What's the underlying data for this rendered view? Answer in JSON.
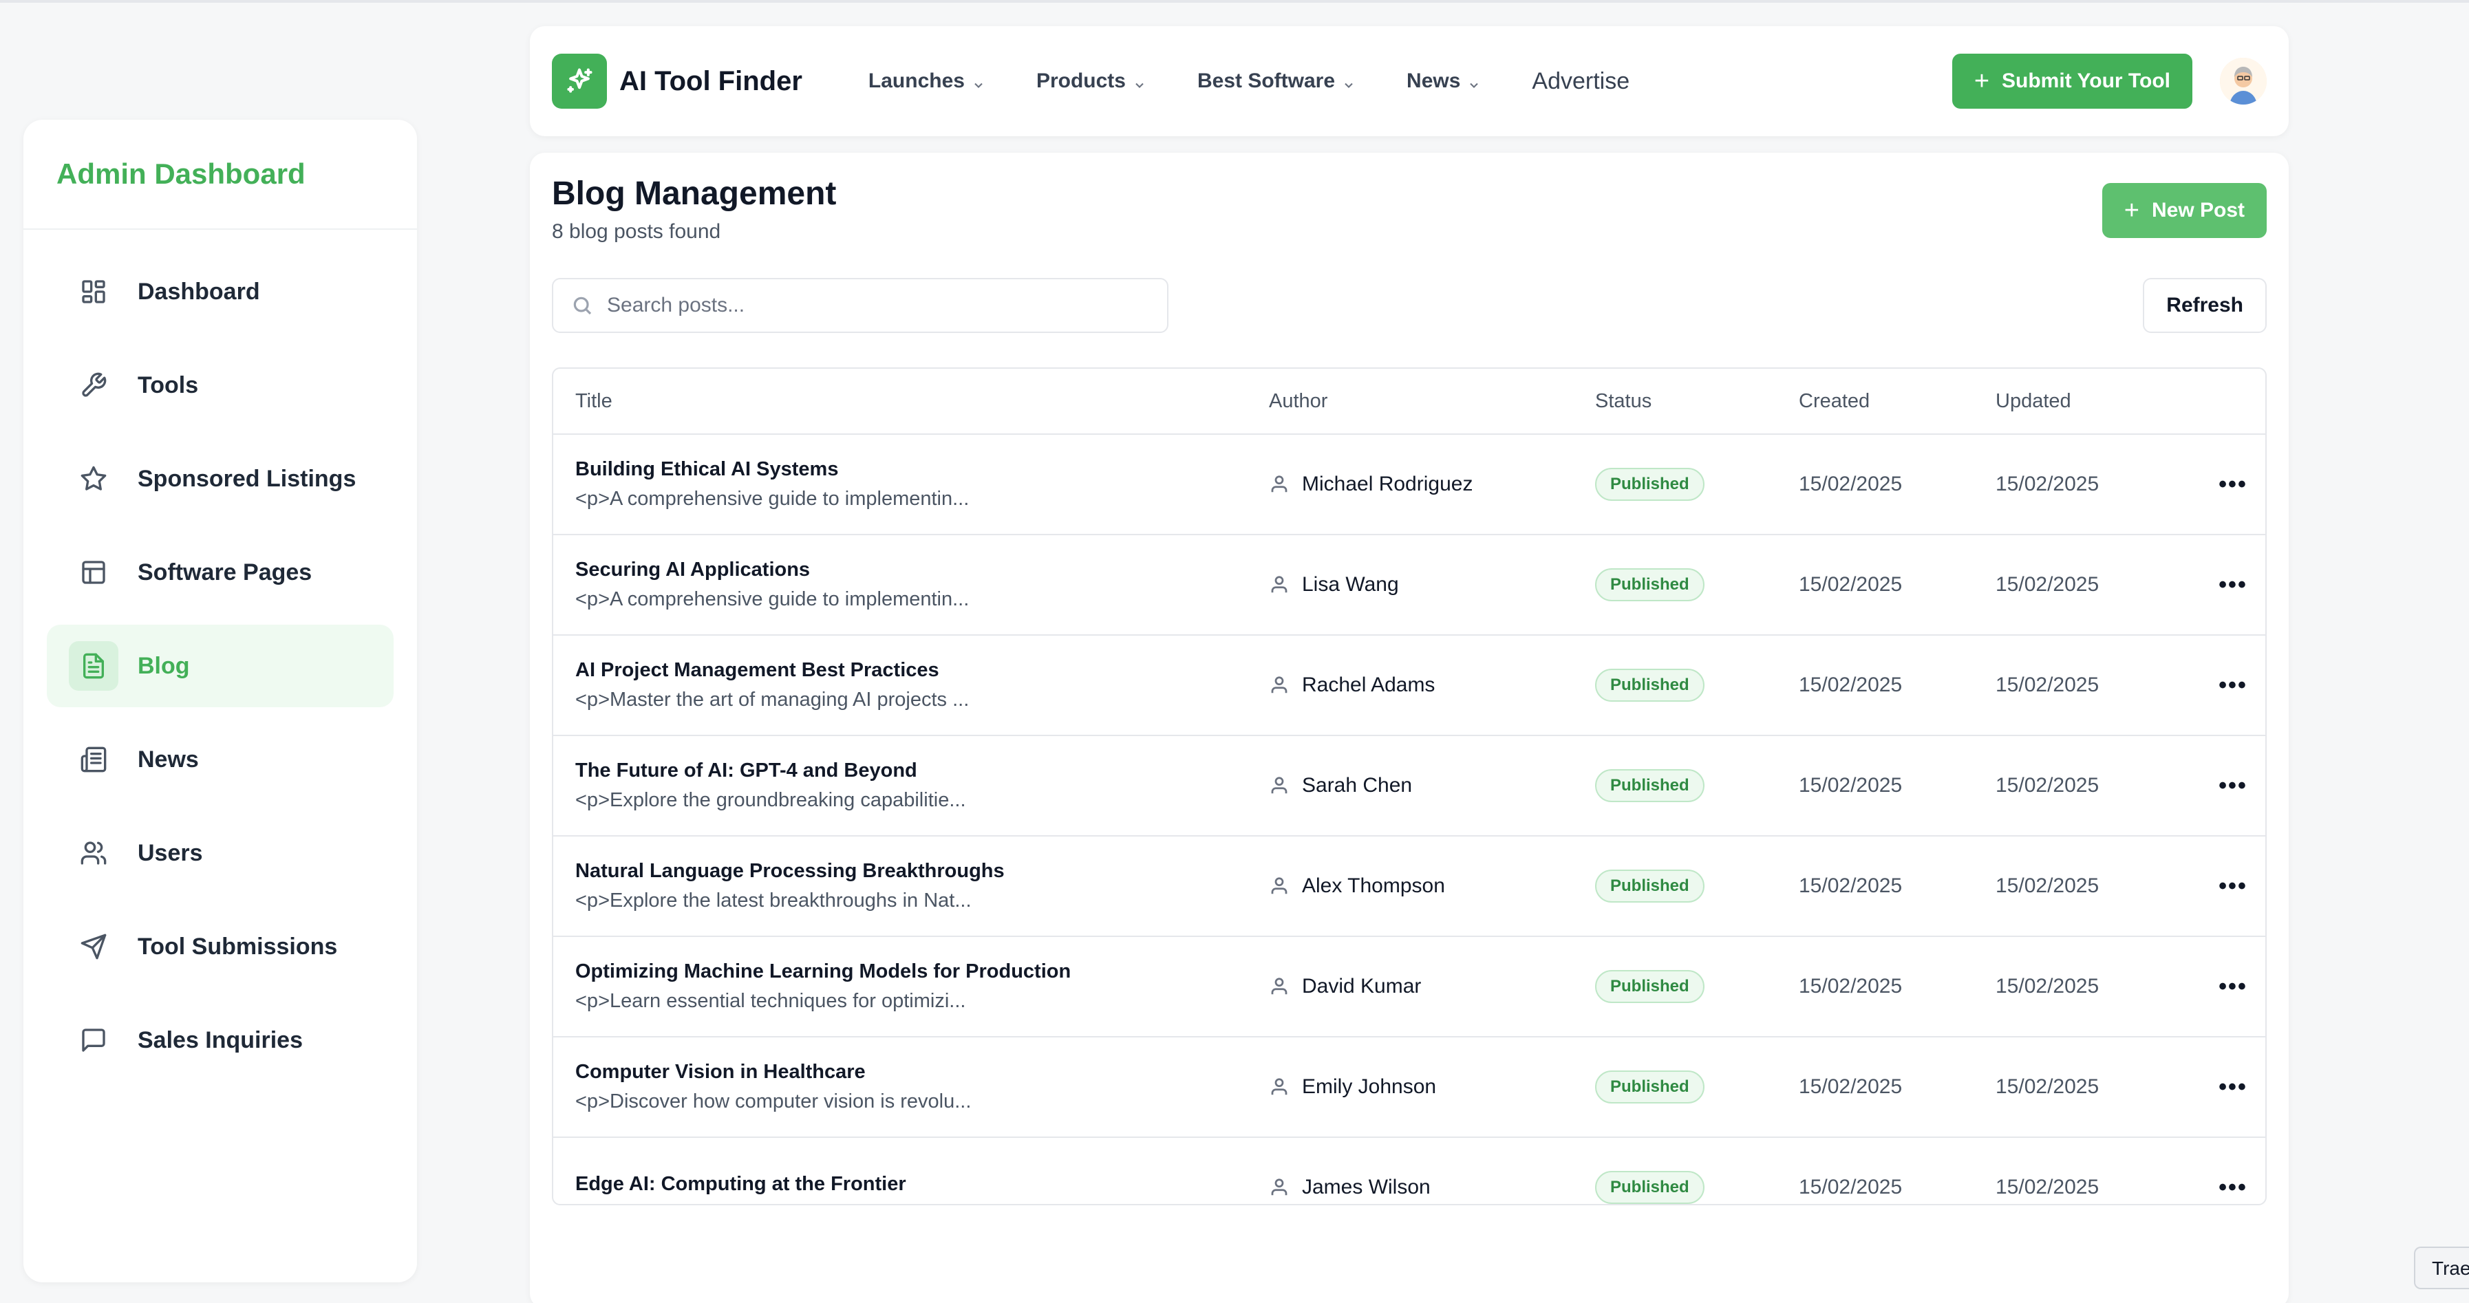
{
  "sidebar": {
    "title": "Admin Dashboard",
    "items": [
      {
        "label": "Dashboard",
        "icon": "dashboard-grid-icon"
      },
      {
        "label": "Tools",
        "icon": "wrench-icon"
      },
      {
        "label": "Sponsored Listings",
        "icon": "star-icon"
      },
      {
        "label": "Software Pages",
        "icon": "layout-icon"
      },
      {
        "label": "Blog",
        "icon": "document-icon",
        "active": true
      },
      {
        "label": "News",
        "icon": "newspaper-icon"
      },
      {
        "label": "Users",
        "icon": "users-icon"
      },
      {
        "label": "Tool Submissions",
        "icon": "send-icon"
      },
      {
        "label": "Sales Inquiries",
        "icon": "message-icon"
      }
    ]
  },
  "topnav": {
    "brand": "AI Tool Finder",
    "menu": [
      "Launches",
      "Products",
      "Best Software",
      "News"
    ],
    "advertise": "Advertise",
    "submit_label": "Submit Your Tool"
  },
  "main": {
    "title": "Blog Management",
    "subtitle": "8 blog posts found",
    "new_post_label": "New Post",
    "search_placeholder": "Search posts...",
    "refresh_label": "Refresh",
    "columns": [
      "Title",
      "Author",
      "Status",
      "Created",
      "Updated"
    ],
    "rows": [
      {
        "title": "Building Ethical AI Systems",
        "excerpt": "<p>A comprehensive guide to implementin...",
        "author": "Michael Rodriguez",
        "status": "Published",
        "created": "15/02/2025",
        "updated": "15/02/2025"
      },
      {
        "title": "Securing AI Applications",
        "excerpt": "<p>A comprehensive guide to implementin...",
        "author": "Lisa Wang",
        "status": "Published",
        "created": "15/02/2025",
        "updated": "15/02/2025"
      },
      {
        "title": "AI Project Management Best Practices",
        "excerpt": "<p>Master the art of managing AI projects ...",
        "author": "Rachel Adams",
        "status": "Published",
        "created": "15/02/2025",
        "updated": "15/02/2025"
      },
      {
        "title": "The Future of AI: GPT-4 and Beyond",
        "excerpt": "<p>Explore the groundbreaking capabilitie...",
        "author": "Sarah Chen",
        "status": "Published",
        "created": "15/02/2025",
        "updated": "15/02/2025"
      },
      {
        "title": "Natural Language Processing Breakthroughs",
        "excerpt": "<p>Explore the latest breakthroughs in Nat...",
        "author": "Alex Thompson",
        "status": "Published",
        "created": "15/02/2025",
        "updated": "15/02/2025"
      },
      {
        "title": "Optimizing Machine Learning Models for Production",
        "excerpt": "<p>Learn essential techniques for optimizi...",
        "author": "David Kumar",
        "status": "Published",
        "created": "15/02/2025",
        "updated": "15/02/2025"
      },
      {
        "title": "Computer Vision in Healthcare",
        "excerpt": "<p>Discover how computer vision is revolu...",
        "author": "Emily Johnson",
        "status": "Published",
        "created": "15/02/2025",
        "updated": "15/02/2025"
      },
      {
        "title": "Edge AI: Computing at the Frontier",
        "excerpt": "",
        "author": "James Wilson",
        "status": "Published",
        "created": "15/02/2025",
        "updated": "15/02/2025"
      }
    ]
  },
  "tray_label": "Trae",
  "colors": {
    "accent": "#43b058",
    "accent_light": "#effaf1",
    "badge_text": "#2f8a42"
  }
}
